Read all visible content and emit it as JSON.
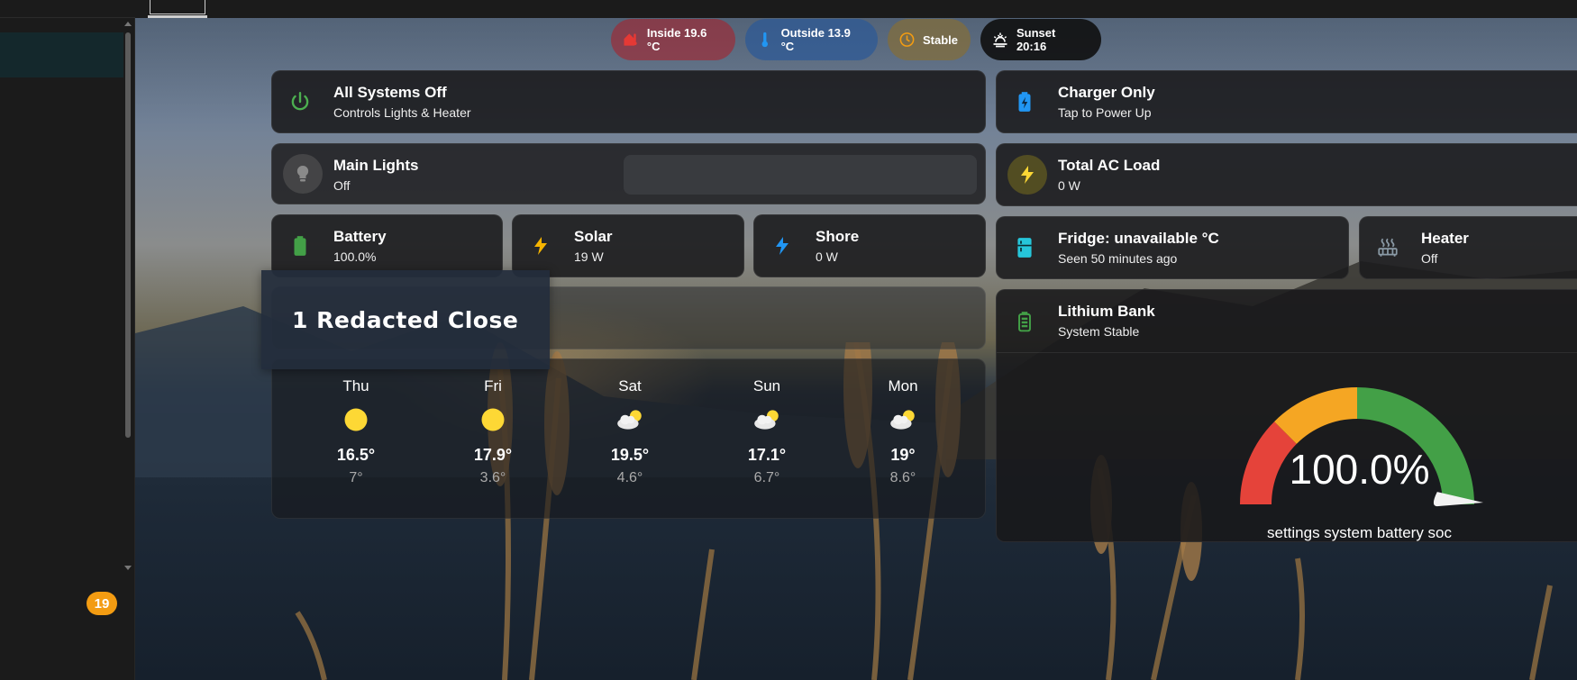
{
  "sidebar": {
    "badge_count": "19"
  },
  "pills": {
    "inside": "Inside 19.6 °C",
    "outside": "Outside 13.9 °C",
    "stable": "Stable",
    "sunset": "Sunset 20:16"
  },
  "cards": {
    "all_systems": {
      "title": "All Systems Off",
      "sub": "Controls Lights & Heater",
      "icon": "power-icon"
    },
    "main_lights": {
      "title": "Main Lights",
      "sub": "Off",
      "icon": "lightbulb-icon"
    },
    "battery": {
      "title": "Battery",
      "sub": "100.0%",
      "icon": "battery-icon"
    },
    "solar": {
      "title": "Solar",
      "sub": "19 W",
      "icon": "lightning-icon"
    },
    "shore": {
      "title": "Shore",
      "sub": "0 W",
      "icon": "lightning-icon"
    },
    "charger": {
      "title": "Charger Only",
      "sub": "Tap to Power Up",
      "icon": "battery-charging-icon"
    },
    "ac_load": {
      "title": "Total AC Load",
      "sub": "0 W",
      "icon": "lightning-icon"
    },
    "fridge": {
      "title": "Fridge: unavailable °C",
      "sub": "Seen 50 minutes ago",
      "icon": "fridge-icon"
    },
    "heater": {
      "title": "Heater",
      "sub": "Off",
      "icon": "radiator-icon"
    },
    "lithium": {
      "title": "Lithium Bank",
      "sub": "System Stable",
      "icon": "battery-icon"
    }
  },
  "redacted": {
    "text": "1 Redacted Close"
  },
  "weather": {
    "days": [
      {
        "name": "Thu",
        "hi": "16.5°",
        "lo": "7°",
        "icon": "sunny-icon"
      },
      {
        "name": "Fri",
        "hi": "17.9°",
        "lo": "3.6°",
        "icon": "sunny-icon"
      },
      {
        "name": "Sat",
        "hi": "19.5°",
        "lo": "4.6°",
        "icon": "partly-cloudy-icon"
      },
      {
        "name": "Sun",
        "hi": "17.1°",
        "lo": "6.7°",
        "icon": "partly-cloudy-icon"
      },
      {
        "name": "Mon",
        "hi": "19°",
        "lo": "8.6°",
        "icon": "partly-cloudy-icon"
      }
    ]
  },
  "gauge": {
    "value": 100.0,
    "value_text": "100.0%",
    "label": "settings system battery soc",
    "colors": {
      "red": "#e5433a",
      "orange": "#f5a623",
      "green": "#43a047"
    },
    "segments": [
      {
        "from": 0,
        "to": 25,
        "color": "red"
      },
      {
        "from": 25,
        "to": 50,
        "color": "orange"
      },
      {
        "from": 50,
        "to": 100,
        "color": "green"
      }
    ]
  }
}
